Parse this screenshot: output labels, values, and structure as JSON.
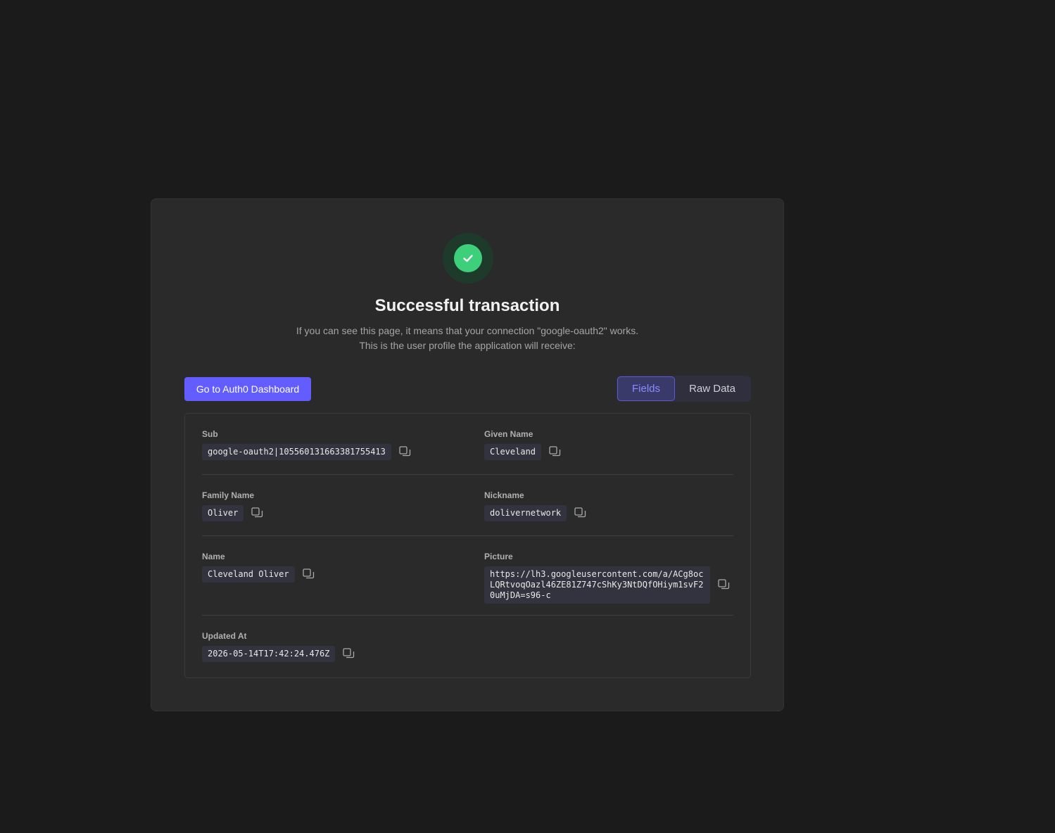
{
  "header": {
    "title": "Successful transaction",
    "description_line1": "If you can see this page, it means that your connection \"google-oauth2\" works.",
    "description_line2": "This is the user profile the application will receive:"
  },
  "actions": {
    "dashboard_button": "Go to Auth0 Dashboard"
  },
  "tabs": [
    {
      "label": "Fields",
      "active": true
    },
    {
      "label": "Raw Data",
      "active": false
    }
  ],
  "fields": {
    "sub": {
      "label": "Sub",
      "value": "google-oauth2|105560131663381755413"
    },
    "given_name": {
      "label": "Given Name",
      "value": "Cleveland"
    },
    "family_name": {
      "label": "Family Name",
      "value": "Oliver"
    },
    "nickname": {
      "label": "Nickname",
      "value": "dolivernetwork"
    },
    "name": {
      "label": "Name",
      "value": "Cleveland Oliver"
    },
    "picture": {
      "label": "Picture",
      "value": "https://lh3.googleusercontent.com/a/ACg8ocLQRtvoqOazl46ZE81Z747cShKy3NtDQfOHiym1svF20uMjDA=s96-c"
    },
    "updated_at": {
      "label": "Updated At",
      "value": "2026-05-14T17:42:24.476Z"
    }
  },
  "colors": {
    "accent": "#635dff",
    "success": "#3ecf7a",
    "background": "#1b1b1b",
    "card": "#2a2a2a"
  },
  "icons": [
    "check-icon",
    "copy-icon"
  ]
}
